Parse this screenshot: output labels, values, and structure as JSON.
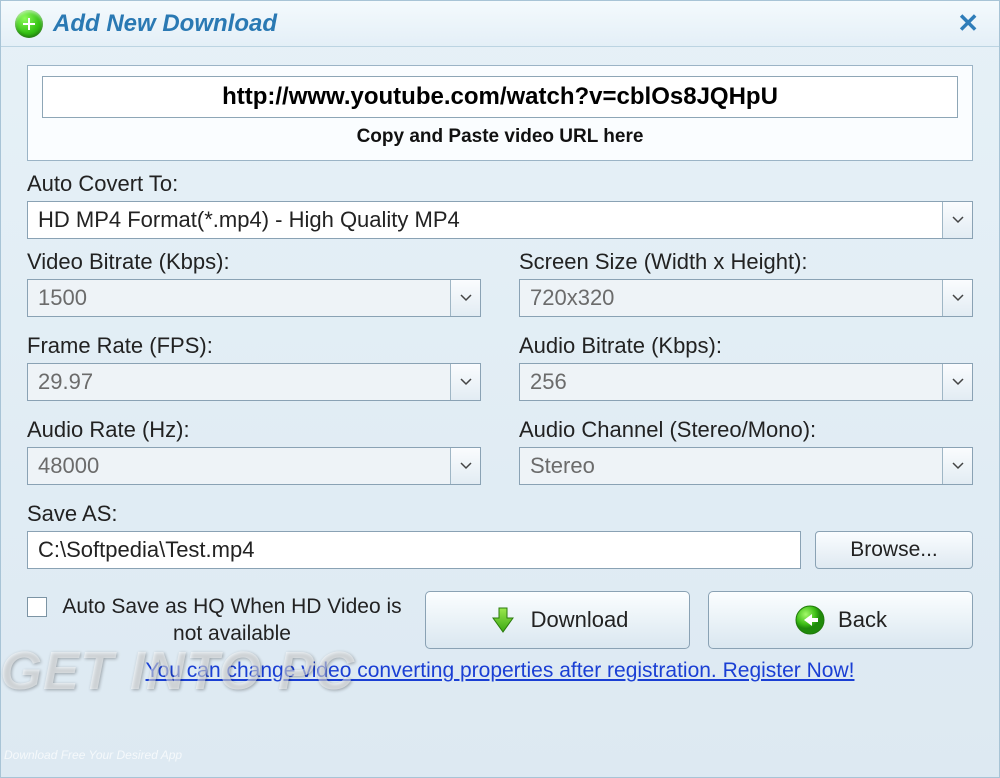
{
  "titlebar": {
    "title": "Add New Download",
    "close": "✕"
  },
  "url": {
    "value": "http://www.youtube.com/watch?v=cblOs8JQHpU",
    "help": "Copy and Paste video URL here"
  },
  "fields": {
    "autoConvert": {
      "label": "Auto Covert To:",
      "value": "HD MP4 Format(*.mp4) - High Quality MP4"
    },
    "videoBitrate": {
      "label": "Video Bitrate (Kbps):",
      "value": "1500"
    },
    "screenSize": {
      "label": "Screen Size (Width x Height):",
      "value": "720x320"
    },
    "frameRate": {
      "label": "Frame Rate (FPS):",
      "value": "29.97"
    },
    "audioBitrate": {
      "label": "Audio Bitrate (Kbps):",
      "value": "256"
    },
    "audioRate": {
      "label": "Audio Rate (Hz):",
      "value": "48000"
    },
    "audioChannel": {
      "label": "Audio Channel (Stereo/Mono):",
      "value": "Stereo"
    },
    "saveAs": {
      "label": "Save AS:",
      "value": "C:\\Softpedia\\Test.mp4"
    }
  },
  "buttons": {
    "browse": "Browse...",
    "download": "Download",
    "back": "Back"
  },
  "checkbox": {
    "label": "Auto Save as HQ When HD Video is not available"
  },
  "registerLink": "You can change video converting properties after registration. Register Now!",
  "watermark": {
    "main": "GET INTO PC",
    "sub": "Download Free Your Desired App"
  }
}
